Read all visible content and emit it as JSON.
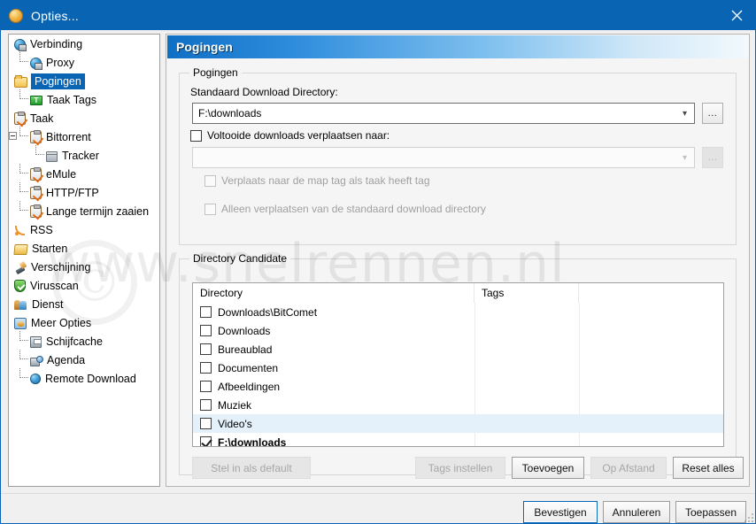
{
  "window": {
    "title": "Opties...",
    "app_icon": "bitcomet-icon",
    "close_label": "✕",
    "titlebar_color": "#0a64b4"
  },
  "sidebar": {
    "items": [
      {
        "label": "Verbinding",
        "icon": "globe-monitor-icon",
        "indent": 0,
        "selected": false,
        "connector": false,
        "expander": false
      },
      {
        "label": "Proxy",
        "icon": "globe-monitor-icon",
        "indent": 1,
        "selected": false,
        "connector": true,
        "expander": false
      },
      {
        "label": "Pogingen",
        "icon": "folder-icon",
        "indent": 0,
        "selected": true,
        "connector": false,
        "expander": false
      },
      {
        "label": "Taak Tags",
        "icon": "tag-icon",
        "indent": 1,
        "selected": false,
        "connector": true,
        "expander": false
      },
      {
        "label": "Taak",
        "icon": "clipboard-icon",
        "indent": 0,
        "selected": false,
        "connector": false,
        "expander": false
      },
      {
        "label": "Bittorrent",
        "icon": "clipboard-icon",
        "indent": 1,
        "selected": false,
        "connector": true,
        "expander": true
      },
      {
        "label": "Tracker",
        "icon": "box-icon",
        "indent": 2,
        "selected": false,
        "connector": true,
        "expander": false
      },
      {
        "label": "eMule",
        "icon": "clipboard-icon",
        "indent": 1,
        "selected": false,
        "connector": true,
        "expander": false
      },
      {
        "label": "HTTP/FTP",
        "icon": "clipboard-icon",
        "indent": 1,
        "selected": false,
        "connector": true,
        "expander": false
      },
      {
        "label": "Lange termijn zaaien",
        "icon": "clipboard-icon",
        "indent": 1,
        "selected": false,
        "connector": true,
        "expander": false
      },
      {
        "label": "RSS",
        "icon": "rss-icon",
        "indent": 0,
        "selected": false,
        "connector": false,
        "expander": false
      },
      {
        "label": "Starten",
        "icon": "start-folder-icon",
        "indent": 0,
        "selected": false,
        "connector": false,
        "expander": false
      },
      {
        "label": "Verschijning",
        "icon": "brush-icon",
        "indent": 0,
        "selected": false,
        "connector": false,
        "expander": false
      },
      {
        "label": "Virusscan",
        "icon": "shield-icon",
        "indent": 0,
        "selected": false,
        "connector": false,
        "expander": false
      },
      {
        "label": "Dienst",
        "icon": "people-icon",
        "indent": 0,
        "selected": false,
        "connector": false,
        "expander": false
      },
      {
        "label": "Meer Opties",
        "icon": "more-options-icon",
        "indent": 0,
        "selected": false,
        "connector": false,
        "expander": false
      },
      {
        "label": "Schijfcache",
        "icon": "disk-icon",
        "indent": 1,
        "selected": false,
        "connector": true,
        "expander": false
      },
      {
        "label": "Agenda",
        "icon": "agenda-icon",
        "indent": 1,
        "selected": false,
        "connector": true,
        "expander": false
      },
      {
        "label": "Remote Download",
        "icon": "globe-icon",
        "indent": 1,
        "selected": false,
        "connector": true,
        "expander": false
      }
    ]
  },
  "page": {
    "banner_title": "Pogingen",
    "group_pogingen": {
      "title": "Pogingen",
      "default_dir_label": "Standaard Download Directory:",
      "default_dir_value": "F:\\downloads",
      "default_dir_browse": "...",
      "move_completed_label": "Voltooide downloads verplaatsen naar:",
      "move_completed_checked": false,
      "move_dir_value": "",
      "move_dir_browse": "...",
      "move_to_tag_folder_label": "Verplaats naar de map tag als taak heeft tag",
      "move_to_tag_folder_checked": false,
      "only_from_default_label": "Alleen verplaatsen van de standaard download directory",
      "only_from_default_checked": false
    },
    "group_dircand": {
      "title": "Directory Candidate",
      "columns": [
        "Directory",
        "Tags"
      ],
      "rows": [
        {
          "directory": "Downloads\\BitComet",
          "tags": "",
          "checked": false,
          "selected": false
        },
        {
          "directory": "Downloads",
          "tags": "",
          "checked": false,
          "selected": false
        },
        {
          "directory": "Bureaublad",
          "tags": "",
          "checked": false,
          "selected": false
        },
        {
          "directory": "Documenten",
          "tags": "",
          "checked": false,
          "selected": false
        },
        {
          "directory": "Afbeeldingen",
          "tags": "",
          "checked": false,
          "selected": false
        },
        {
          "directory": "Muziek",
          "tags": "",
          "checked": false,
          "selected": false
        },
        {
          "directory": "Video's",
          "tags": "",
          "checked": false,
          "selected": true
        },
        {
          "directory": "F:\\downloads",
          "tags": "",
          "checked": true,
          "selected": false
        }
      ],
      "buttons": {
        "set_default": "Stel in als default",
        "set_tags": "Tags instellen",
        "add": "Toevoegen",
        "remote": "Op Afstand",
        "reset_all": "Reset alles"
      }
    }
  },
  "footer": {
    "ok": "Bevestigen",
    "cancel": "Annuleren",
    "apply": "Toepassen"
  },
  "watermark": {
    "text": "www.snelrennen.nl",
    "copyright": "©"
  }
}
